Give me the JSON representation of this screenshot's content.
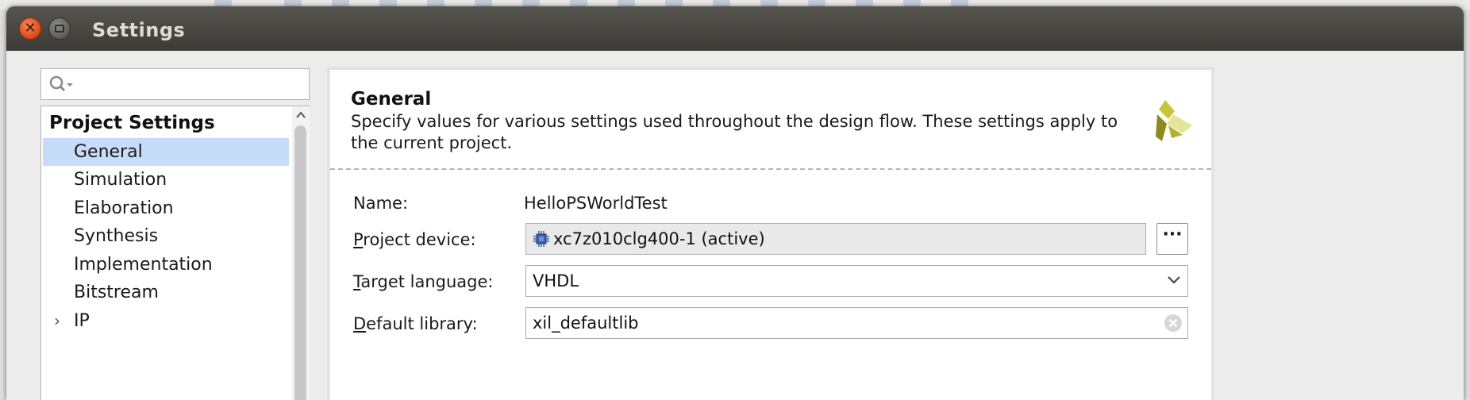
{
  "window": {
    "title": "Settings"
  },
  "sidebar": {
    "search_placeholder": "",
    "section_title": "Project Settings",
    "items": [
      {
        "label": "General",
        "selected": true
      },
      {
        "label": "Simulation"
      },
      {
        "label": "Elaboration"
      },
      {
        "label": "Synthesis"
      },
      {
        "label": "Implementation"
      },
      {
        "label": "Bitstream"
      },
      {
        "label": "IP",
        "expandable": true
      }
    ]
  },
  "panel": {
    "title": "General",
    "description": "Specify values for various settings used throughout the design flow. These settings apply to the current project.",
    "name_label": "Name:",
    "name_value": "HelloPSWorldTest",
    "device_label_mnemonic": "P",
    "device_label_rest": "roject device:",
    "device_value": "xc7z010clg400-1 (active)",
    "device_button_label": "···",
    "language_label_mnemonic": "T",
    "language_label_rest": "arget language:",
    "language_value": "VHDL",
    "library_label_mnemonic": "D",
    "library_label_rest": "efault library:",
    "library_value": "xil_defaultlib"
  },
  "colors": {
    "titlebar": "#3c3b37",
    "close_button": "#dd4814",
    "selection": "#c7dcf8",
    "logo_yellow": "#c9c53a"
  },
  "icons": [
    "close-icon",
    "minimize-icon",
    "search-icon",
    "scroll-up-icon",
    "xilinx-logo-icon",
    "chip-icon",
    "chevron-down-icon",
    "clear-icon",
    "chevron-right-icon"
  ]
}
